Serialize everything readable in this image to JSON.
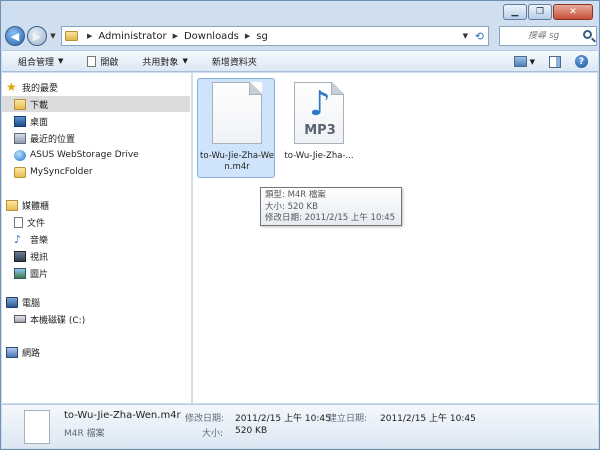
{
  "address": {
    "crumbs": [
      "Administrator",
      "Downloads",
      "sg"
    ],
    "search_placeholder": "搜尋 sg"
  },
  "toolbar": {
    "organize": "組合管理",
    "open": "開啟",
    "share": "共用對象",
    "new_folder": "新增資料夾"
  },
  "sidebar": {
    "favorites": "我的最愛",
    "downloads": "下載",
    "desktop": "桌面",
    "recent": "最近的位置",
    "asus": "ASUS WebStorage Drive",
    "mysync": "MySyncFolder",
    "libraries": "媒體櫃",
    "documents": "文件",
    "music": "音樂",
    "videos": "視訊",
    "pictures": "圖片",
    "computer": "電腦",
    "local_disk": "本機磁碟 (C:)",
    "network": "網路"
  },
  "files": [
    {
      "name": "to-Wu-Jie-Zha-Wen.m4r",
      "selected": true
    },
    {
      "name": "to-Wu-Jie-Zha-...",
      "badge": "MP3",
      "selected": false
    }
  ],
  "tooltip": {
    "type": "類型: M4R 檔案",
    "size": "大小: 520 KB",
    "modified": "修改日期: 2011/2/15 上午 10:45"
  },
  "details": {
    "name": "to-Wu-Jie-Zha-Wen.m4r",
    "type": "M4R 檔案",
    "modified_label": "修改日期:",
    "modified_value": "2011/2/15 上午 10:45",
    "size_label": "大小:",
    "size_value": "520 KB",
    "created_label": "建立日期:",
    "created_value": "2011/2/15 上午 10:45"
  },
  "colors": {
    "frame": "#cfdff0",
    "selection": "#cfe4fb",
    "accent": "#2e78c9"
  }
}
